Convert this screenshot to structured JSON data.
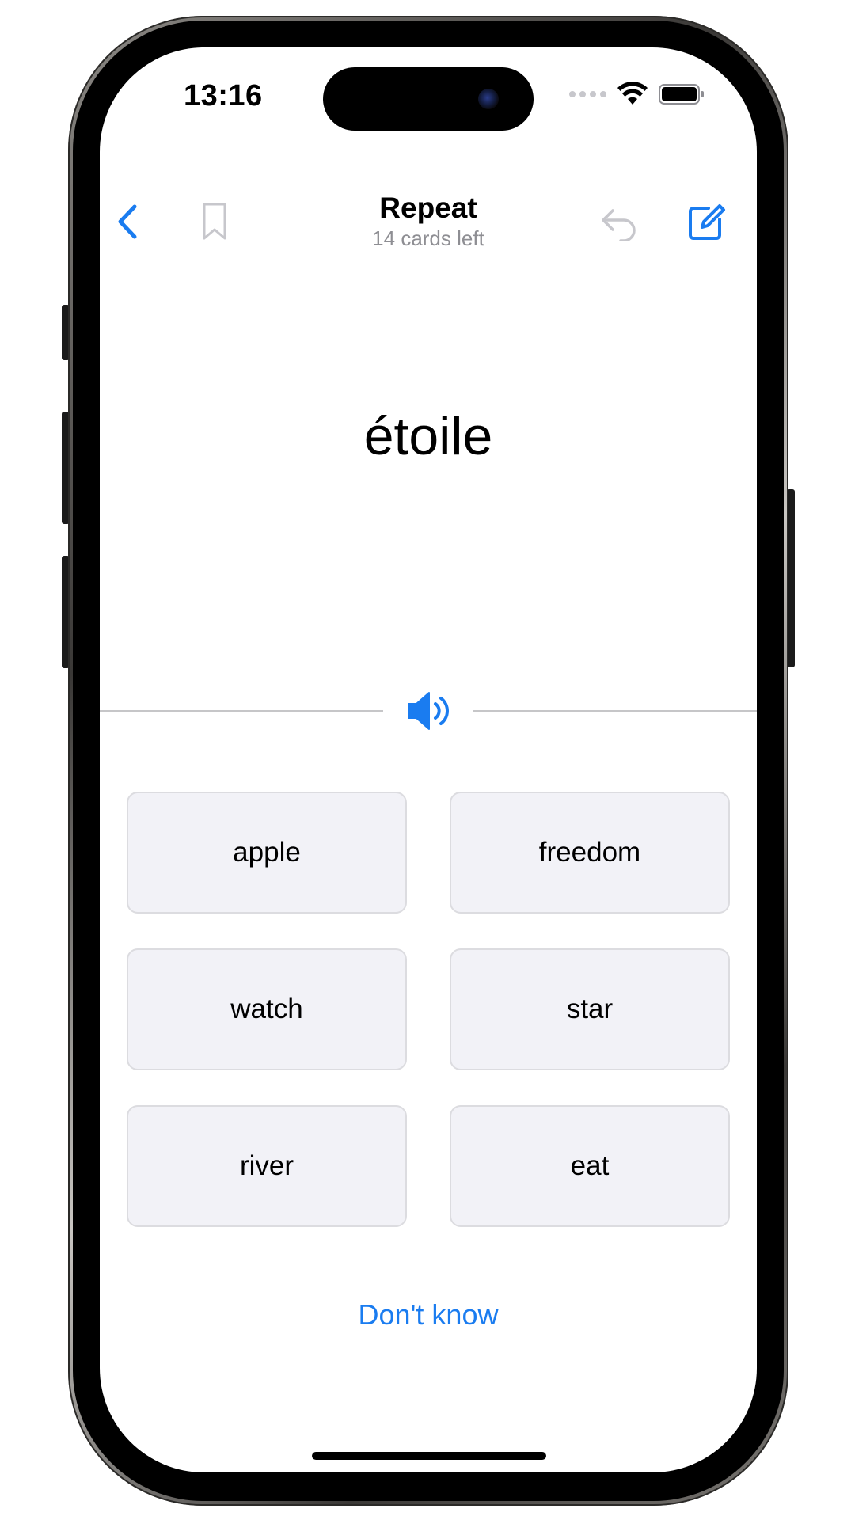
{
  "status_bar": {
    "time": "13:16"
  },
  "nav": {
    "title": "Repeat",
    "subtitle": "14 cards left",
    "icons": {
      "back": "chevron-left-icon",
      "bookmark": "bookmark-icon",
      "undo": "undo-icon",
      "edit": "compose-icon"
    }
  },
  "card": {
    "word": "étoile",
    "audio_icon": "speaker-icon"
  },
  "answers": [
    {
      "label": "apple"
    },
    {
      "label": "freedom"
    },
    {
      "label": "watch"
    },
    {
      "label": "star"
    },
    {
      "label": "river"
    },
    {
      "label": "eat"
    }
  ],
  "actions": {
    "dont_know": "Don't know"
  },
  "colors": {
    "accent": "#1a7cf0",
    "answer_bg": "#f2f2f7",
    "disabled": "#c7c7cc"
  }
}
